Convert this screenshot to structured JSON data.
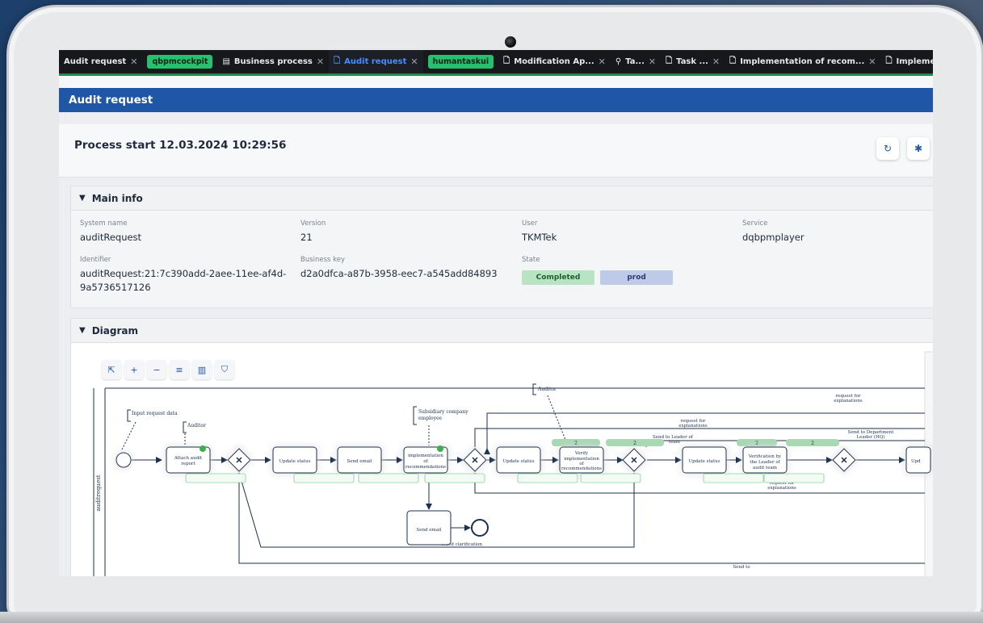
{
  "tabs": [
    {
      "label": "Audit request",
      "type": "normal",
      "closable": true
    },
    {
      "label": "qbpmcockpit",
      "type": "pill",
      "closable": false
    },
    {
      "label": "Business process",
      "type": "normal",
      "closable": true,
      "icon": "app-icon"
    },
    {
      "label": "Audit request",
      "type": "active",
      "closable": true,
      "icon": "document-icon"
    },
    {
      "label": "humantaskui",
      "type": "pill",
      "closable": false
    },
    {
      "label": "Modification Ap...",
      "type": "normal",
      "closable": true,
      "icon": "document-icon"
    },
    {
      "label": "Ta...",
      "type": "normal",
      "closable": true,
      "icon": "user-task-icon"
    },
    {
      "label": "Task ...",
      "type": "normal",
      "closable": true,
      "icon": "document-icon"
    },
    {
      "label": "Implementation of recom...",
      "type": "normal",
      "closable": true,
      "icon": "document-icon"
    },
    {
      "label": "Implementation of reco",
      "type": "normal",
      "closable": false,
      "icon": "document-icon"
    }
  ],
  "header": {
    "title": "Audit request"
  },
  "process": {
    "title": "Process start 12.03.2024 10:29:56"
  },
  "main_info": {
    "title": "Main info",
    "system_name_label": "System name",
    "system_name": "auditRequest",
    "version_label": "Version",
    "version": "21",
    "user_label": "User",
    "user": "TKMTek",
    "service_label": "Service",
    "service": "dqbpmplayer",
    "identifier_label": "Identifier",
    "identifier_line1": "auditRequest:21:7c390add-2aee-11ee-af4d-",
    "identifier_line2": "9a5736517126",
    "business_key_label": "Business key",
    "business_key": "d2a0dfca-a87b-3958-eec7-a545add84893",
    "state_label": "State",
    "state": "Completed",
    "environment": "prod"
  },
  "diagram": {
    "title": "Diagram",
    "lane": "auditrequest",
    "annotations": {
      "input": "Input request data",
      "auditor1": "Auditor",
      "subsidiary1": "Subsidiary company",
      "subsidiary2": "employee",
      "auditor2": "Auditor"
    },
    "tasks": {
      "attach1": "Attach audit",
      "attach2": "report",
      "update1": "Update status",
      "email1": "Send email",
      "impl1": "implementation",
      "impl2": "of",
      "impl3": "recommendations",
      "update2": "Update status",
      "verify1": "Verify",
      "verify2": "implementation",
      "verify3": "of",
      "verify4": "recommendations",
      "update3": "Update status",
      "verif1": "Verification by",
      "verif2": "the Leader of",
      "verif3": "audit team",
      "email2": "Send email",
      "upd_partial": "Upd"
    },
    "flows": {
      "req_expl_top1": "request for",
      "req_expl_top2": "explanations",
      "req_expl_mid1": "request for",
      "req_expl_mid2": "explanations",
      "send_leader1": "Send to Leader of",
      "send_leader2": "team",
      "send_dept1": "Send to Department",
      "send_dept2": "Leader (HQ)",
      "req_expl_bot1": "request for",
      "req_expl_bot2": "explanations",
      "need_clar": "Need clarification",
      "send_to": "Send to"
    },
    "counts": {
      "c1": "2",
      "c2": "2",
      "c3": "2",
      "c4": "2"
    }
  }
}
